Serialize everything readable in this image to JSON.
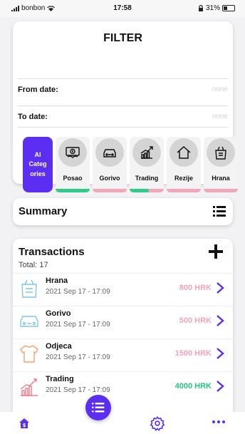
{
  "status_bar": {
    "carrier": "bonbon",
    "time": "17:58",
    "battery": "31%"
  },
  "filter": {
    "title": "FILTER",
    "from_label": "From date:",
    "from_value": "none",
    "to_label": "To date:",
    "to_value": "none",
    "all_label_lines": [
      "Al",
      "Categ",
      "ories"
    ],
    "categories": [
      {
        "name": "Posao",
        "icon": "money-icon",
        "bar": "green"
      },
      {
        "name": "Gorivo",
        "icon": "car-icon",
        "bar": "pink"
      },
      {
        "name": "Trading",
        "icon": "trading-chart-icon",
        "bar": "split"
      },
      {
        "name": "Rezije",
        "icon": "house-icon",
        "bar": "pink"
      },
      {
        "name": "Hrana",
        "icon": "grocery-bag-icon",
        "bar": "pink"
      }
    ]
  },
  "summary": {
    "title": "Summary",
    "icon": "list-icon"
  },
  "transactions": {
    "title": "Transactions",
    "total": "Total: 17",
    "items": [
      {
        "name": "Hrana",
        "date": "2021 Sep 17 - 17:09",
        "amount": "800 HRK",
        "icon": "grocery-bag-icon"
      },
      {
        "name": "Gorivo",
        "date": "2021 Sep 17 - 17:09",
        "amount": "500 HRK",
        "icon": "car-icon"
      },
      {
        "name": "Odjeca",
        "date": "2021 Sep 17 - 17:09",
        "amount": "1500 HRK",
        "icon": "tshirt-icon"
      },
      {
        "name": "Trading",
        "date": "2021 Sep 17 - 17:09",
        "amount": "4000 HRK",
        "icon": "trading-chart-icon"
      }
    ]
  },
  "colors": {
    "accent": "#5b2ef2",
    "expense": "#f3a3b8",
    "income": "#22c77e",
    "pink_bar": "#f2a7b8",
    "green_bar": "#2ecc8a"
  },
  "tab_bar": {
    "icons": [
      "home-dollar-icon",
      "list-menu-icon",
      "settings-gear-icon",
      "more-dots-icon"
    ]
  }
}
